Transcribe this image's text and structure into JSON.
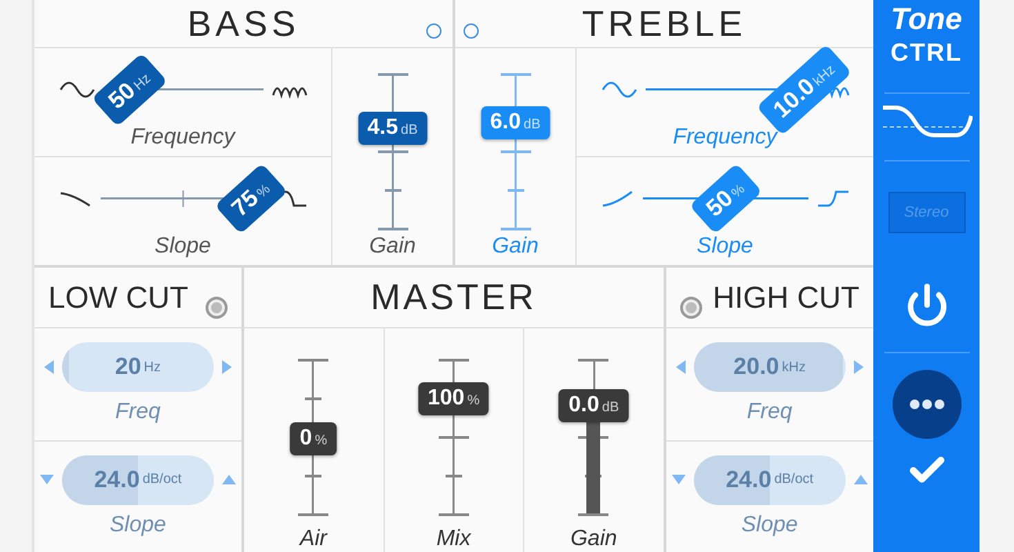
{
  "bands": [
    {
      "title": "BASS",
      "color": "#0b5cad",
      "toggle": {
        "on": false
      },
      "frequency": {
        "label": "Frequency",
        "value": "50",
        "unit": "Hz",
        "level": 0.26
      },
      "slope": {
        "label": "Slope",
        "value": "75",
        "unit": "%",
        "level": 0.8
      },
      "gain": {
        "label": "Gain",
        "value": "4.5",
        "unit": "dB",
        "level": 0.64
      }
    },
    {
      "title": "TREBLE",
      "color": "#1a8cf5",
      "toggle": {
        "on": false
      },
      "frequency": {
        "label": "Frequency",
        "value": "10.0",
        "unit": "kHz",
        "level": 0.86
      },
      "slope": {
        "label": "Slope",
        "value": "50",
        "unit": "%",
        "level": 0.5
      },
      "gain": {
        "label": "Gain",
        "value": "6.0",
        "unit": "dB",
        "level": 0.68
      }
    }
  ],
  "low_cut": {
    "title": "LOW CUT",
    "on": false,
    "controls": [
      {
        "label": "Freq",
        "value": "20",
        "unit": "Hz",
        "level": 0.05
      },
      {
        "label": "Slope",
        "value": "24.0",
        "unit": "dB/oct",
        "level": 0.5
      }
    ]
  },
  "master": {
    "title": "MASTER",
    "controls": [
      {
        "kind": "fader",
        "label": "Air",
        "value": "0",
        "unit": "%",
        "level": 0.48
      },
      {
        "kind": "fader",
        "label": "Mix",
        "value": "100",
        "unit": "%",
        "level": 0.74
      },
      {
        "kind": "meter",
        "label": "Gain",
        "value": "0.0",
        "unit": "dB",
        "level": 0.7
      }
    ]
  },
  "high_cut": {
    "title": "HIGH CUT",
    "on": false,
    "controls": [
      {
        "label": "Freq",
        "value": "20.0",
        "unit": "kHz",
        "level": 0.98
      },
      {
        "label": "Slope",
        "value": "24.0",
        "unit": "dB/oct",
        "level": 0.5
      }
    ]
  },
  "sidebar": {
    "logo_top": "Tone",
    "logo_bottom": "CTRL",
    "stereo": {
      "label": "Stereo",
      "selected": false
    },
    "power": {
      "on": true
    }
  }
}
